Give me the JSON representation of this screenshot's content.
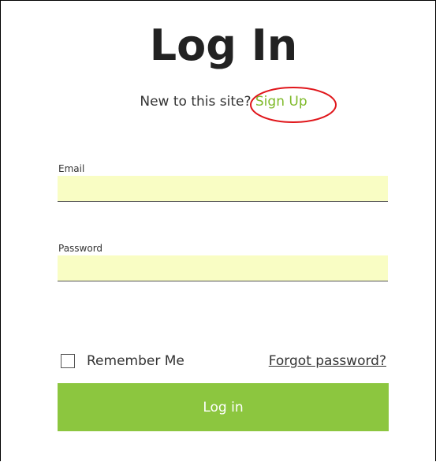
{
  "page": {
    "title": "Log In",
    "subtitle_prefix": "New to this site?",
    "signup_label": "Sign Up"
  },
  "form": {
    "email_label": "Email",
    "email_value": "",
    "password_label": "Password",
    "password_value": "",
    "remember_label": "Remember Me",
    "remember_checked": false,
    "forgot_label": "Forgot password?",
    "submit_label": "Log in"
  },
  "colors": {
    "accent": "#8cc63f",
    "link": "#7fba2a",
    "input_background": "#f9fdc4",
    "annotation_circle": "#e0161b"
  }
}
